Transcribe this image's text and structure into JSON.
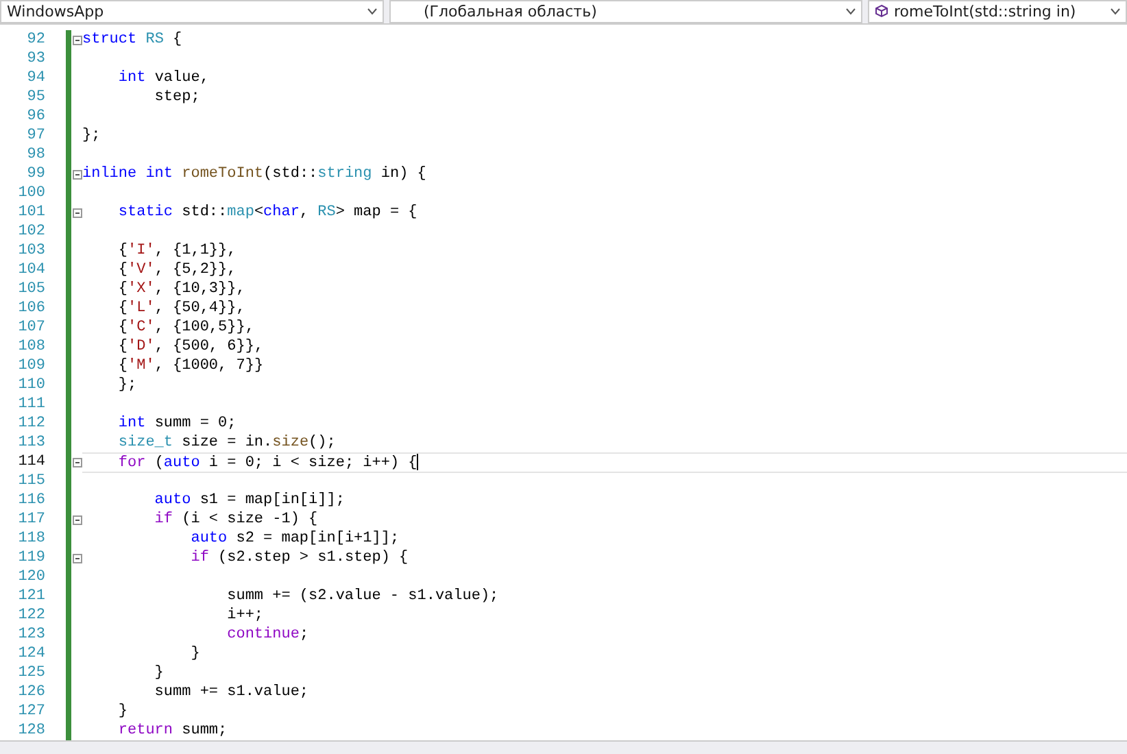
{
  "navigation_bar": {
    "dropdowns": [
      {
        "label": "WindowsApp",
        "kind": "project"
      },
      {
        "label": "(Глобальная область)",
        "kind": "scope"
      },
      {
        "label": "romeToInt(std::string in)",
        "kind": "member"
      }
    ]
  },
  "editor": {
    "lines": [
      {
        "num": "92",
        "fold": true,
        "current": false,
        "tokens": [
          {
            "t": "struct ",
            "kind": "keyword"
          },
          {
            "t": "RS",
            "kind": "type"
          },
          {
            "t": " {",
            "kind": "plain"
          }
        ]
      },
      {
        "num": "93",
        "fold": false,
        "current": false
      },
      {
        "num": "94",
        "fold": false,
        "current": false,
        "tokens": [
          {
            "t": "    int",
            "kind": "keyword"
          },
          {
            "t": " value,",
            "kind": "plain"
          }
        ]
      },
      {
        "num": "95",
        "fold": false,
        "current": false,
        "tokens": [
          {
            "t": "        step;",
            "kind": "plain"
          }
        ]
      },
      {
        "num": "96",
        "fold": false,
        "current": false
      },
      {
        "num": "97",
        "fold": false,
        "current": false,
        "tokens": [
          {
            "t": "};",
            "kind": "plain"
          }
        ]
      },
      {
        "num": "98",
        "fold": false,
        "current": false
      },
      {
        "num": "99",
        "fold": true,
        "current": false,
        "tokens": [
          {
            "t": "inline int ",
            "kind": "keyword"
          },
          {
            "t": "romeToInt",
            "kind": "function"
          },
          {
            "t": "(std::",
            "kind": "plain"
          },
          {
            "t": "string",
            "kind": "type"
          },
          {
            "t": " in) {",
            "kind": "plain"
          }
        ]
      },
      {
        "num": "100",
        "fold": false,
        "current": false
      },
      {
        "num": "101",
        "fold": true,
        "current": false,
        "tokens": [
          {
            "t": "    static",
            "kind": "keyword"
          },
          {
            "t": " std::",
            "kind": "plain"
          },
          {
            "t": "map",
            "kind": "type"
          },
          {
            "t": "<",
            "kind": "plain"
          },
          {
            "t": "char",
            "kind": "keyword"
          },
          {
            "t": ", ",
            "kind": "plain"
          },
          {
            "t": "RS",
            "kind": "type"
          },
          {
            "t": "> map = {",
            "kind": "plain"
          }
        ]
      },
      {
        "num": "102",
        "fold": false,
        "current": false
      },
      {
        "num": "103",
        "fold": false,
        "current": false,
        "tokens": [
          {
            "t": "    {",
            "kind": "plain"
          },
          {
            "t": "'I'",
            "kind": "string"
          },
          {
            "t": ", {1,1}},",
            "kind": "plain"
          }
        ]
      },
      {
        "num": "104",
        "fold": false,
        "current": false,
        "tokens": [
          {
            "t": "    {",
            "kind": "plain"
          },
          {
            "t": "'V'",
            "kind": "string"
          },
          {
            "t": ", {5,2}},",
            "kind": "plain"
          }
        ]
      },
      {
        "num": "105",
        "fold": false,
        "current": false,
        "tokens": [
          {
            "t": "    {",
            "kind": "plain"
          },
          {
            "t": "'X'",
            "kind": "string"
          },
          {
            "t": ", {10,3}},",
            "kind": "plain"
          }
        ]
      },
      {
        "num": "106",
        "fold": false,
        "current": false,
        "tokens": [
          {
            "t": "    {",
            "kind": "plain"
          },
          {
            "t": "'L'",
            "kind": "string"
          },
          {
            "t": ", {50,4}},",
            "kind": "plain"
          }
        ]
      },
      {
        "num": "107",
        "fold": false,
        "current": false,
        "tokens": [
          {
            "t": "    {",
            "kind": "plain"
          },
          {
            "t": "'C'",
            "kind": "string"
          },
          {
            "t": ", {100,5}},",
            "kind": "plain"
          }
        ]
      },
      {
        "num": "108",
        "fold": false,
        "current": false,
        "tokens": [
          {
            "t": "    {",
            "kind": "plain"
          },
          {
            "t": "'D'",
            "kind": "string"
          },
          {
            "t": ", {500, 6}},",
            "kind": "plain"
          }
        ]
      },
      {
        "num": "109",
        "fold": false,
        "current": false,
        "tokens": [
          {
            "t": "    {",
            "kind": "plain"
          },
          {
            "t": "'M'",
            "kind": "string"
          },
          {
            "t": ", {1000, 7}}",
            "kind": "plain"
          }
        ]
      },
      {
        "num": "110",
        "fold": false,
        "current": false,
        "tokens": [
          {
            "t": "    };",
            "kind": "plain"
          }
        ]
      },
      {
        "num": "111",
        "fold": false,
        "current": false
      },
      {
        "num": "112",
        "fold": false,
        "current": false,
        "tokens": [
          {
            "t": "    int",
            "kind": "keyword"
          },
          {
            "t": " summ = 0;",
            "kind": "plain"
          }
        ]
      },
      {
        "num": "113",
        "fold": false,
        "current": false,
        "tokens": [
          {
            "t": "    size_t",
            "kind": "type"
          },
          {
            "t": " size = in.",
            "kind": "plain"
          },
          {
            "t": "size",
            "kind": "function"
          },
          {
            "t": "();",
            "kind": "plain"
          }
        ]
      },
      {
        "num": "114",
        "fold": true,
        "current": true,
        "tokens": [
          {
            "t": "    for",
            "kind": "control"
          },
          {
            "t": " (",
            "kind": "plain"
          },
          {
            "t": "auto",
            "kind": "keyword"
          },
          {
            "t": " i = 0; i < size; i++) {",
            "kind": "plain"
          }
        ]
      },
      {
        "num": "115",
        "fold": false,
        "current": false
      },
      {
        "num": "116",
        "fold": false,
        "current": false,
        "tokens": [
          {
            "t": "        auto",
            "kind": "keyword"
          },
          {
            "t": " s1 = map[in[i]];",
            "kind": "plain"
          }
        ]
      },
      {
        "num": "117",
        "fold": true,
        "current": false,
        "tokens": [
          {
            "t": "        if",
            "kind": "control"
          },
          {
            "t": " (i < size -1) {",
            "kind": "plain"
          }
        ]
      },
      {
        "num": "118",
        "fold": false,
        "current": false,
        "tokens": [
          {
            "t": "            auto",
            "kind": "keyword"
          },
          {
            "t": " s2 = map[in[i+1]];",
            "kind": "plain"
          }
        ]
      },
      {
        "num": "119",
        "fold": true,
        "current": false,
        "tokens": [
          {
            "t": "            if",
            "kind": "control"
          },
          {
            "t": " (s2.step > s1.step) {",
            "kind": "plain"
          }
        ]
      },
      {
        "num": "120",
        "fold": false,
        "current": false
      },
      {
        "num": "121",
        "fold": false,
        "current": false,
        "tokens": [
          {
            "t": "                summ += (s2.value - s1.value);",
            "kind": "plain"
          }
        ]
      },
      {
        "num": "122",
        "fold": false,
        "current": false,
        "tokens": [
          {
            "t": "                i++;",
            "kind": "plain"
          }
        ]
      },
      {
        "num": "123",
        "fold": false,
        "current": false,
        "tokens": [
          {
            "t": "                continue",
            "kind": "control"
          },
          {
            "t": ";",
            "kind": "plain"
          }
        ]
      },
      {
        "num": "124",
        "fold": false,
        "current": false,
        "tokens": [
          {
            "t": "            }",
            "kind": "plain"
          }
        ]
      },
      {
        "num": "125",
        "fold": false,
        "current": false,
        "tokens": [
          {
            "t": "        }",
            "kind": "plain"
          }
        ]
      },
      {
        "num": "126",
        "fold": false,
        "current": false,
        "tokens": [
          {
            "t": "        summ += s1.value;",
            "kind": "plain"
          }
        ]
      },
      {
        "num": "127",
        "fold": false,
        "current": false,
        "tokens": [
          {
            "t": "    }",
            "kind": "plain"
          }
        ]
      },
      {
        "num": "128",
        "fold": false,
        "current": false,
        "tokens": [
          {
            "t": "    return",
            "kind": "control"
          },
          {
            "t": " summ;",
            "kind": "plain"
          }
        ]
      }
    ]
  }
}
